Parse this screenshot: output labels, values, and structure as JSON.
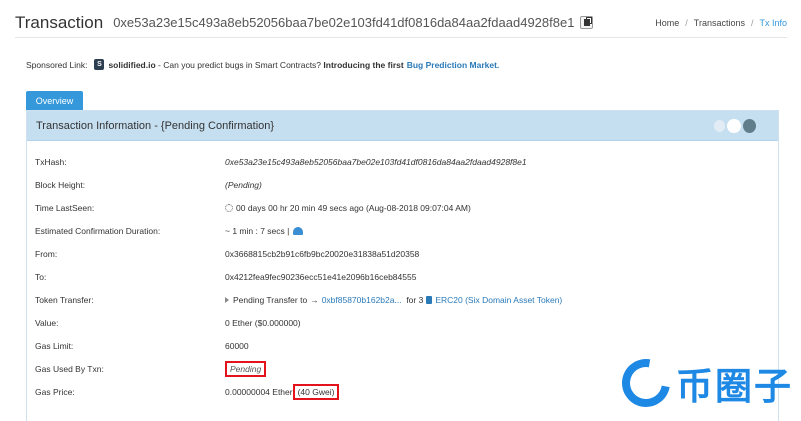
{
  "header": {
    "title": "Transaction",
    "hash": "0xe53a23e15c493a8eb52056baa7be02e103fd41df0816da84aa2fdaad4928f8e1",
    "breadcrumbs": [
      "Home",
      "Transactions",
      "Tx Info"
    ]
  },
  "sponsor": {
    "label": "Sponsored Link:",
    "brand": "solidified.io",
    "text": "- Can you predict bugs in Smart Contracts?",
    "bold": "Introducing the first",
    "link": "Bug Prediction Market."
  },
  "tab": {
    "label": "Overview"
  },
  "panel": {
    "title": "Transaction Information - {Pending Confirmation}"
  },
  "rows": {
    "txhash": {
      "key": "TxHash:",
      "value": "0xe53a23e15c493a8eb52056baa7be02e103fd41df0816da84aa2fdaad4928f8e1"
    },
    "block": {
      "key": "Block Height:",
      "value": "(Pending)"
    },
    "time": {
      "key": "Time LastSeen:",
      "value": "00 days 00 hr 20 min 49 secs ago (Aug-08-2018 09:07:04 AM)"
    },
    "ecd": {
      "key": "Estimated Confirmation Duration:",
      "value": "~ 1 min : 7 secs |"
    },
    "from": {
      "key": "From:",
      "value": "0x3668815cb2b91c6fb9bc20020e31838a51d20358"
    },
    "to": {
      "key": "To:",
      "value": "0x4212fea9fec90236ecc51e41e2096b16ceb84555"
    },
    "token": {
      "key": "Token Transfer:",
      "prefix": "Pending Transfer to",
      "arrow": "→",
      "addr": "0xbf85870b162b2a...",
      "mid": "for 3",
      "tokenName": "ERC20 (Six Domain Asset Token)"
    },
    "value": {
      "key": "Value:",
      "value": "0 Ether ($0.000000)"
    },
    "gaslimit": {
      "key": "Gas Limit:",
      "value": "60000"
    },
    "gasused": {
      "key": "Gas Used By Txn:",
      "value": "Pending"
    },
    "gasprice": {
      "key": "Gas Price:",
      "value": "0.00000004 Ether",
      "gwei": "(40 Gwei)"
    }
  },
  "watermark": {
    "text": "币圈子"
  },
  "colors": {
    "accent": "#3498db",
    "link": "#2a7ab8",
    "highlight": "#e3121b"
  }
}
